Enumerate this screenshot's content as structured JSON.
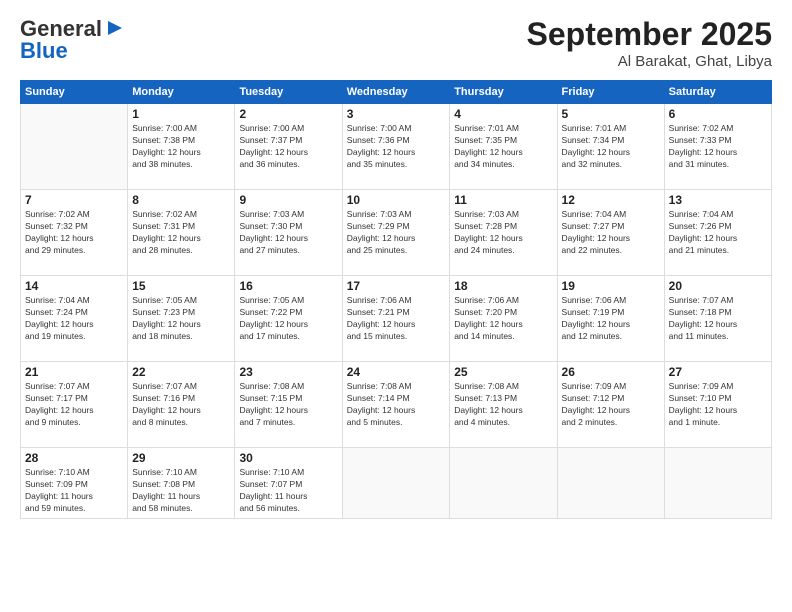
{
  "logo": {
    "line1": "General",
    "line2": "Blue"
  },
  "header": {
    "month": "September 2025",
    "location": "Al Barakat, Ghat, Libya"
  },
  "weekdays": [
    "Sunday",
    "Monday",
    "Tuesday",
    "Wednesday",
    "Thursday",
    "Friday",
    "Saturday"
  ],
  "weeks": [
    [
      {
        "day": "",
        "info": ""
      },
      {
        "day": "1",
        "info": "Sunrise: 7:00 AM\nSunset: 7:38 PM\nDaylight: 12 hours\nand 38 minutes."
      },
      {
        "day": "2",
        "info": "Sunrise: 7:00 AM\nSunset: 7:37 PM\nDaylight: 12 hours\nand 36 minutes."
      },
      {
        "day": "3",
        "info": "Sunrise: 7:00 AM\nSunset: 7:36 PM\nDaylight: 12 hours\nand 35 minutes."
      },
      {
        "day": "4",
        "info": "Sunrise: 7:01 AM\nSunset: 7:35 PM\nDaylight: 12 hours\nand 34 minutes."
      },
      {
        "day": "5",
        "info": "Sunrise: 7:01 AM\nSunset: 7:34 PM\nDaylight: 12 hours\nand 32 minutes."
      },
      {
        "day": "6",
        "info": "Sunrise: 7:02 AM\nSunset: 7:33 PM\nDaylight: 12 hours\nand 31 minutes."
      }
    ],
    [
      {
        "day": "7",
        "info": "Sunrise: 7:02 AM\nSunset: 7:32 PM\nDaylight: 12 hours\nand 29 minutes."
      },
      {
        "day": "8",
        "info": "Sunrise: 7:02 AM\nSunset: 7:31 PM\nDaylight: 12 hours\nand 28 minutes."
      },
      {
        "day": "9",
        "info": "Sunrise: 7:03 AM\nSunset: 7:30 PM\nDaylight: 12 hours\nand 27 minutes."
      },
      {
        "day": "10",
        "info": "Sunrise: 7:03 AM\nSunset: 7:29 PM\nDaylight: 12 hours\nand 25 minutes."
      },
      {
        "day": "11",
        "info": "Sunrise: 7:03 AM\nSunset: 7:28 PM\nDaylight: 12 hours\nand 24 minutes."
      },
      {
        "day": "12",
        "info": "Sunrise: 7:04 AM\nSunset: 7:27 PM\nDaylight: 12 hours\nand 22 minutes."
      },
      {
        "day": "13",
        "info": "Sunrise: 7:04 AM\nSunset: 7:26 PM\nDaylight: 12 hours\nand 21 minutes."
      }
    ],
    [
      {
        "day": "14",
        "info": "Sunrise: 7:04 AM\nSunset: 7:24 PM\nDaylight: 12 hours\nand 19 minutes."
      },
      {
        "day": "15",
        "info": "Sunrise: 7:05 AM\nSunset: 7:23 PM\nDaylight: 12 hours\nand 18 minutes."
      },
      {
        "day": "16",
        "info": "Sunrise: 7:05 AM\nSunset: 7:22 PM\nDaylight: 12 hours\nand 17 minutes."
      },
      {
        "day": "17",
        "info": "Sunrise: 7:06 AM\nSunset: 7:21 PM\nDaylight: 12 hours\nand 15 minutes."
      },
      {
        "day": "18",
        "info": "Sunrise: 7:06 AM\nSunset: 7:20 PM\nDaylight: 12 hours\nand 14 minutes."
      },
      {
        "day": "19",
        "info": "Sunrise: 7:06 AM\nSunset: 7:19 PM\nDaylight: 12 hours\nand 12 minutes."
      },
      {
        "day": "20",
        "info": "Sunrise: 7:07 AM\nSunset: 7:18 PM\nDaylight: 12 hours\nand 11 minutes."
      }
    ],
    [
      {
        "day": "21",
        "info": "Sunrise: 7:07 AM\nSunset: 7:17 PM\nDaylight: 12 hours\nand 9 minutes."
      },
      {
        "day": "22",
        "info": "Sunrise: 7:07 AM\nSunset: 7:16 PM\nDaylight: 12 hours\nand 8 minutes."
      },
      {
        "day": "23",
        "info": "Sunrise: 7:08 AM\nSunset: 7:15 PM\nDaylight: 12 hours\nand 7 minutes."
      },
      {
        "day": "24",
        "info": "Sunrise: 7:08 AM\nSunset: 7:14 PM\nDaylight: 12 hours\nand 5 minutes."
      },
      {
        "day": "25",
        "info": "Sunrise: 7:08 AM\nSunset: 7:13 PM\nDaylight: 12 hours\nand 4 minutes."
      },
      {
        "day": "26",
        "info": "Sunrise: 7:09 AM\nSunset: 7:12 PM\nDaylight: 12 hours\nand 2 minutes."
      },
      {
        "day": "27",
        "info": "Sunrise: 7:09 AM\nSunset: 7:10 PM\nDaylight: 12 hours\nand 1 minute."
      }
    ],
    [
      {
        "day": "28",
        "info": "Sunrise: 7:10 AM\nSunset: 7:09 PM\nDaylight: 11 hours\nand 59 minutes."
      },
      {
        "day": "29",
        "info": "Sunrise: 7:10 AM\nSunset: 7:08 PM\nDaylight: 11 hours\nand 58 minutes."
      },
      {
        "day": "30",
        "info": "Sunrise: 7:10 AM\nSunset: 7:07 PM\nDaylight: 11 hours\nand 56 minutes."
      },
      {
        "day": "",
        "info": ""
      },
      {
        "day": "",
        "info": ""
      },
      {
        "day": "",
        "info": ""
      },
      {
        "day": "",
        "info": ""
      }
    ]
  ]
}
